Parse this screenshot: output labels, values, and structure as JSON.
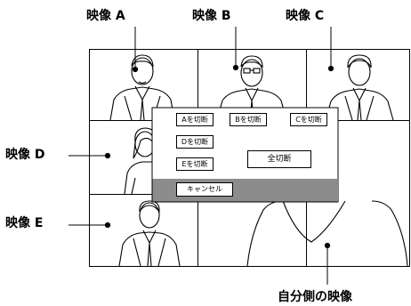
{
  "callouts": {
    "video_a": "映像 A",
    "video_b": "映像 B",
    "video_c": "映像 C",
    "video_d": "映像 D",
    "video_e": "映像 E",
    "self_view": "自分側の映像"
  },
  "dialog": {
    "disconnect_a": "Aを切断",
    "disconnect_b": "Bを切断",
    "disconnect_c": "Cを切断",
    "disconnect_d": "Dを切断",
    "disconnect_e": "Eを切断",
    "disconnect_all": "全切断",
    "cancel": "キャンセル"
  },
  "colors": {
    "dialog_bar": "#8c8c8c",
    "line": "#000000"
  }
}
